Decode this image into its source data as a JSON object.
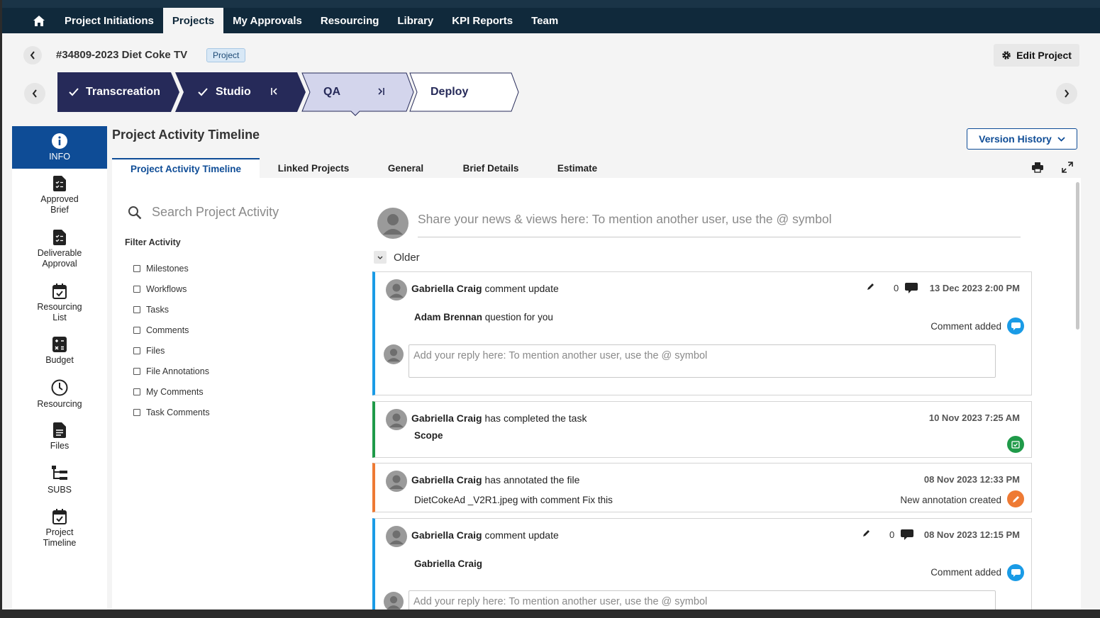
{
  "nav": {
    "items": [
      "Project Initiations",
      "Projects",
      "My Approvals",
      "Resourcing",
      "Library",
      "KPI Reports",
      "Team"
    ],
    "active": "Projects"
  },
  "header": {
    "title": "#34809-2023 Diet Coke TV",
    "badge": "Project",
    "edit_label": "Edit Project"
  },
  "stages": [
    "Transcreation",
    "Studio",
    "QA",
    "Deploy"
  ],
  "sidebar": {
    "items": [
      {
        "label": "INFO",
        "icon": "info-icon"
      },
      {
        "label": "Approved\nBrief",
        "icon": "document-check-icon"
      },
      {
        "label": "Deliverable\nApproval",
        "icon": "document-check-icon"
      },
      {
        "label": "Resourcing\nList",
        "icon": "calendar-check-icon"
      },
      {
        "label": "Budget",
        "icon": "calculator-icon"
      },
      {
        "label": "Resourcing",
        "icon": "clock-icon"
      },
      {
        "label": "Files",
        "icon": "file-icon"
      },
      {
        "label": "SUBS",
        "icon": "hierarchy-icon"
      },
      {
        "label": "Project\nTimeline",
        "icon": "calendar-check-icon"
      }
    ]
  },
  "main": {
    "title": "Project Activity Timeline",
    "version_history": "Version History",
    "tabs": [
      "Project Activity Timeline",
      "Linked Projects",
      "General",
      "Brief Details",
      "Estimate"
    ],
    "search_placeholder": "Search Project Activity",
    "filter_title": "Filter Activity",
    "filters": [
      "Milestones",
      "Workflows",
      "Tasks",
      "Comments",
      "Files",
      "File Annotations",
      "My Comments",
      "Task Comments"
    ],
    "share_placeholder": "Share your news & views here:  To mention another user, use the @ symbol",
    "older_label": "Older",
    "reply_placeholder": "Add your reply here:  To mention another user, use the @ symbol"
  },
  "activity": [
    {
      "user": "Gabriella Craig",
      "action": " comment update",
      "count": "0",
      "date": "13 Dec 2023 2:00 PM",
      "body_bold": "Adam Brennan",
      "body": " question for you",
      "status": "Comment added",
      "color": "#1a9be6"
    },
    {
      "user": "Gabriella Craig",
      "action": " has completed the task",
      "date": "10 Nov 2023 7:25 AM",
      "body_bold": "Scope",
      "color": "#1f9a49"
    },
    {
      "user": "Gabriella Craig",
      "action": " has annotated the file",
      "date": "08 Nov 2023 12:33 PM",
      "body": "DietCokeAd _V2R1.jpeg with comment Fix this",
      "status": "New annotation created",
      "color": "#ee7a34"
    },
    {
      "user": "Gabriella Craig",
      "action": " comment update",
      "count": "0",
      "date": "08 Nov 2023 12:15 PM",
      "body_bold": "Gabriella Craig",
      "status": "Comment added",
      "color": "#1a9be6"
    }
  ],
  "colors": {
    "nav_bg": "#10293b",
    "accent": "#0e4c96",
    "stage_done": "#262a59",
    "stage_current": "#d3d5ec"
  }
}
